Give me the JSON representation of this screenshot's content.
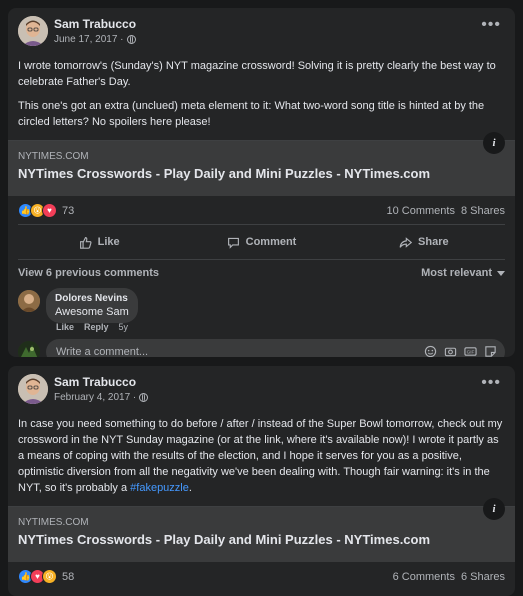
{
  "posts": [
    {
      "author": "Sam Trabucco",
      "date": "June 17, 2017 ·",
      "paragraphs": [
        "I wrote tomorrow's (Sunday's) NYT magazine crossword! Solving it is pretty clearly the best way to celebrate Father's Day.",
        "This one's got an extra (unclued) meta element to it: What two-word song title is hinted at by the circled letters? No spoilers here please!"
      ],
      "link": {
        "domain": "NYTIMES.COM",
        "title": "NYTimes Crosswords - Play Daily and Mini Puzzles - NYTimes.com",
        "info": "i"
      },
      "reactions": {
        "count": "73",
        "types": [
          "like-icon",
          "wow-icon",
          "love-icon"
        ]
      },
      "comments_count": "10 Comments",
      "shares_count": "8 Shares",
      "actions": {
        "like": "Like",
        "comment": "Comment",
        "share": "Share"
      },
      "view_previous": "View 6 previous comments",
      "sort": "Most relevant",
      "comment": {
        "author": "Dolores Nevins",
        "text": "Awesome Sam",
        "like": "Like",
        "reply": "Reply",
        "time": "5y"
      },
      "write_placeholder": "Write a comment..."
    },
    {
      "author": "Sam Trabucco",
      "date": "February 4, 2017 ·",
      "text_before": "In case you need something to do before / after / instead of the Super Bowl tomorrow, check out my crossword in the NYT Sunday magazine (or at the link, where it's available now)! I wrote it partly as a means of coping with the results of the election, and I hope it serves for you as a positive, optimistic diversion from all the negativity we've been dealing with. Though fair warning: it's in the NYT, so it's probably a ",
      "hashtag": "#fakepuzzle",
      "text_after": ".",
      "link": {
        "domain": "NYTIMES.COM",
        "title": "NYTimes Crosswords - Play Daily and Mini Puzzles - NYTimes.com",
        "info": "i"
      },
      "reactions": {
        "count": "58",
        "types": [
          "like-icon",
          "love-icon",
          "wow-icon"
        ]
      },
      "comments_count": "6 Comments",
      "shares_count": "6 Shares"
    }
  ],
  "colors": {
    "background": "#18191a",
    "card": "#242526",
    "link_card": "#3a3b3c",
    "hashtag": "#4599ff",
    "like": "#2e89ff",
    "love": "#f33e58",
    "wow": "#f7b125"
  }
}
